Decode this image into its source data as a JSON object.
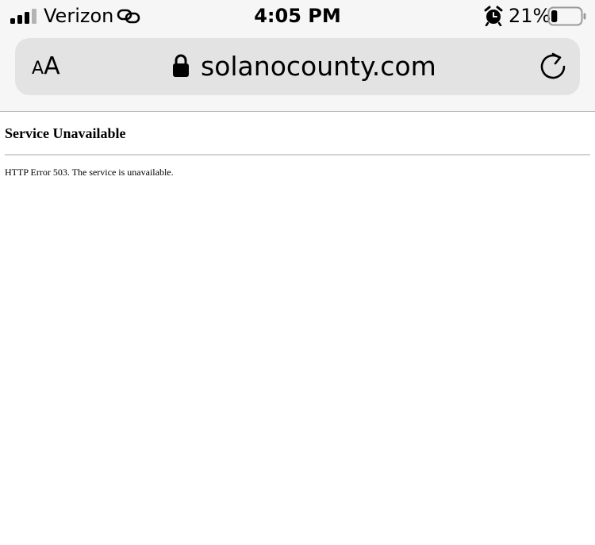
{
  "status_bar": {
    "carrier": "Verizon",
    "time": "4:05 PM",
    "battery_percent": "21%",
    "battery_level": 0.21,
    "signal_bars": 3,
    "signal_bars_total": 4,
    "icons": [
      "signal-icon",
      "link-icon",
      "alarm-icon",
      "battery-icon"
    ]
  },
  "address_bar": {
    "text_size_small": "A",
    "text_size_large": "A",
    "url": "solanocounty.com",
    "icons": [
      "lock-icon",
      "reload-icon"
    ]
  },
  "page": {
    "heading": "Service Unavailable",
    "message": "HTTP Error 503. The service is unavailable."
  }
}
